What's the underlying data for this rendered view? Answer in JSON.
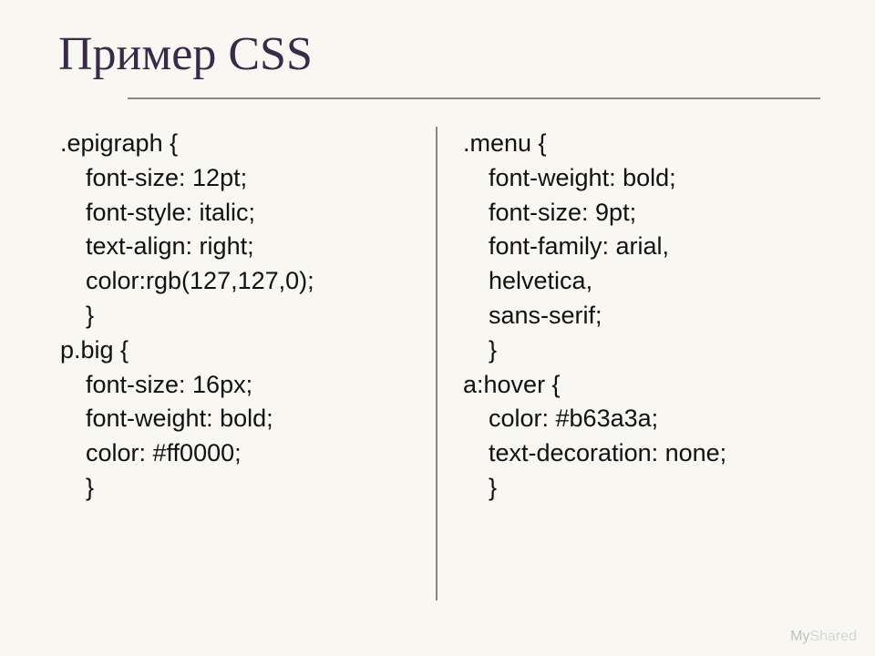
{
  "title": "Пример CSS",
  "left": {
    "block1": {
      "selector": ".epigraph {",
      "l1": "font-size: 12pt;",
      "l2": "font-style: italic;",
      "l3": "text-align: right;",
      "l4": "color:rgb(127,127,0);",
      "close": "}"
    },
    "block2": {
      "selector": "p.big {",
      "l1": "font-size: 16px;",
      "l2": "font-weight: bold;",
      "l3": "color: #ff0000;",
      "close": "}"
    }
  },
  "right": {
    "block1": {
      "selector": ".menu {",
      "l1": "font-weight: bold;",
      "l2": "font-size: 9pt;",
      "l3": "font-family: arial,",
      "l4": "helvetica,",
      "l5": "sans-serif;",
      "close": "}"
    },
    "block2": {
      "selector": "a:hover {",
      "l1": "color: #b63a3a;",
      "l2": "text-decoration: none;",
      "close": "}"
    }
  },
  "footer": {
    "my": "My",
    "shared": "Shared"
  }
}
